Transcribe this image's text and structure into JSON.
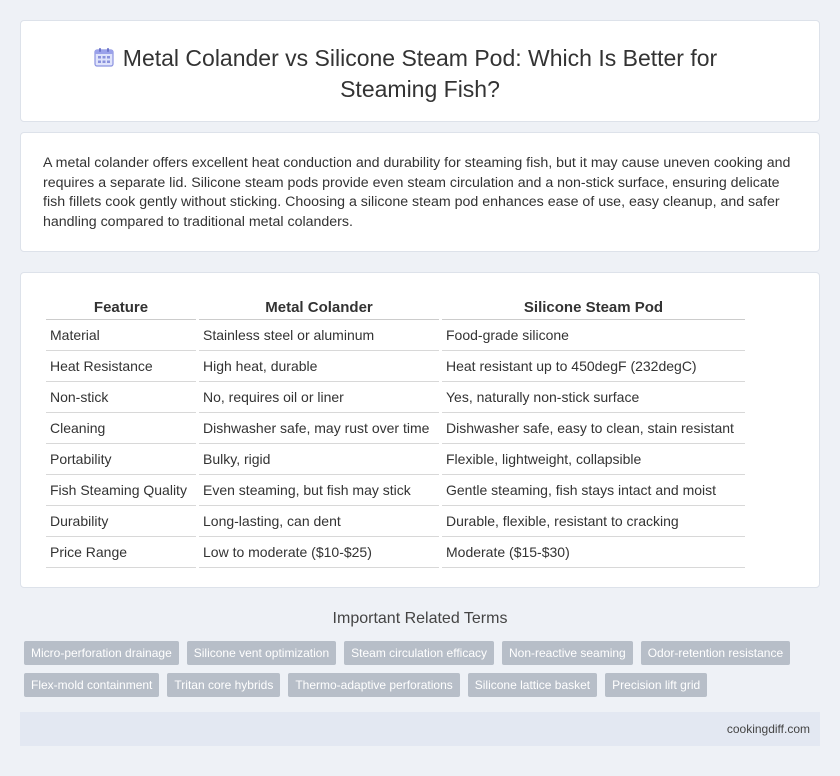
{
  "page": {
    "title": "Metal Colander vs Silicone Steam Pod: Which Is Better for Steaming Fish?",
    "title_icon": "calendar-icon"
  },
  "summary": "A metal colander offers excellent heat conduction and durability for steaming fish, but it may cause uneven cooking and requires a separate lid. Silicone steam pods provide even steam circulation and a non-stick surface, ensuring delicate fish fillets cook gently without sticking. Choosing a silicone steam pod enhances ease of use, easy cleanup, and safer handling compared to traditional metal colanders.",
  "table": {
    "headers": [
      "Feature",
      "Metal Colander",
      "Silicone Steam Pod"
    ],
    "rows": [
      [
        "Material",
        "Stainless steel or aluminum",
        "Food-grade silicone"
      ],
      [
        "Heat Resistance",
        "High heat, durable",
        "Heat resistant up to 450degF (232degC)"
      ],
      [
        "Non-stick",
        "No, requires oil or liner",
        "Yes, naturally non-stick surface"
      ],
      [
        "Cleaning",
        "Dishwasher safe, may rust over time",
        "Dishwasher safe, easy to clean, stain resistant"
      ],
      [
        "Portability",
        "Bulky, rigid",
        "Flexible, lightweight, collapsible"
      ],
      [
        "Fish Steaming Quality",
        "Even steaming, but fish may stick",
        "Gentle steaming, fish stays intact and moist"
      ],
      [
        "Durability",
        "Long-lasting, can dent",
        "Durable, flexible, resistant to cracking"
      ],
      [
        "Price Range",
        "Low to moderate ($10-$25)",
        "Moderate ($15-$30)"
      ]
    ]
  },
  "related": {
    "title": "Important Related Terms",
    "tags_row1": [
      "Micro-perforation drainage",
      "Silicone vent optimization",
      "Steam circulation efficacy",
      "Non-reactive seaming",
      "Odor-retention resistance"
    ],
    "tags_row2": [
      "Flex-mold containment",
      "Tritan core hybrids",
      "Thermo-adaptive perforations",
      "Silicone lattice basket",
      "Precision lift grid"
    ]
  },
  "footer": {
    "site": "cookingdiff.com"
  },
  "colors": {
    "background": "#eef1f6",
    "tag_bg": "#b7bec8",
    "footer_bg": "#e3e8f2"
  }
}
